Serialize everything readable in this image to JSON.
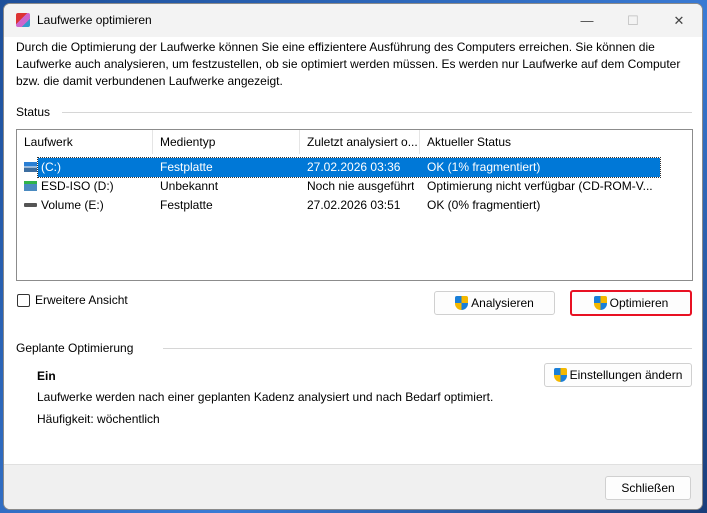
{
  "window": {
    "title": "Laufwerke optimieren",
    "minimize": "—",
    "maximize": "☐",
    "close": "✕"
  },
  "intro": "Durch die Optimierung der Laufwerke können Sie eine effizientere Ausführung des Computers erreichen. Sie können die Laufwerke auch analysieren, um festzustellen, ob sie optimiert werden müssen. Es werden nur Laufwerke auf dem Computer bzw. die damit verbundenen Laufwerke angezeigt.",
  "status": {
    "label": "Status",
    "columns": [
      "Laufwerk",
      "Medientyp",
      "Zuletzt analysiert o...",
      "Aktueller Status"
    ],
    "rows": [
      {
        "drive": "(C:)",
        "media": "Festplatte",
        "last": "27.02.2026 03:36",
        "state": "OK (1% fragmentiert)",
        "icon": "windows-drive-icon",
        "selected": true
      },
      {
        "drive": "ESD-ISO (D:)",
        "media": "Unbekannt",
        "last": "Noch nie ausgeführt",
        "state": "Optimierung nicht verfügbar (CD-ROM-V...",
        "icon": "disc-drive-icon"
      },
      {
        "drive": "Volume (E:)",
        "media": "Festplatte",
        "last": "27.02.2026 03:51",
        "state": "OK (0% fragmentiert)",
        "icon": "hard-drive-icon"
      }
    ]
  },
  "advanced_view": "Erweitere Ansicht",
  "buttons": {
    "analyze": "Analysieren",
    "optimize": "Optimieren",
    "change_settings": "Einstellungen ändern",
    "close": "Schließen"
  },
  "scheduled": {
    "label": "Geplante Optimierung",
    "state": "Ein",
    "description": "Laufwerke werden nach einer geplanten Kadenz analysiert und nach Bedarf optimiert.",
    "frequency": "Häufigkeit: wöchentlich"
  },
  "colors": {
    "selection": "#0078d7",
    "highlight_border": "#e81123"
  }
}
